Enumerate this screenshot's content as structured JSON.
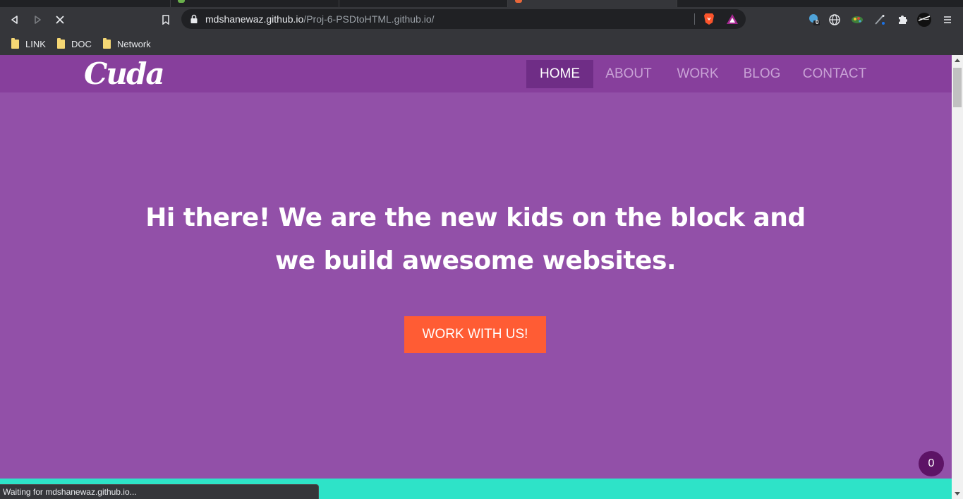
{
  "browser": {
    "url_host": "mdshanewaz.github.io",
    "url_path": "/Proj-6-PSDtoHTML.github.io/",
    "status_text": "Waiting for mdshanewaz.github.io...",
    "extension_badge": "0",
    "bookmarks": [
      {
        "label": "LINK"
      },
      {
        "label": "DOC"
      },
      {
        "label": "Network"
      }
    ],
    "icons": [
      "back-icon",
      "forward-icon",
      "stop-icon",
      "bookmark-icon",
      "lock-icon",
      "brave-shields-icon",
      "brave-rewards-icon",
      "extension-icon",
      "globe-icon",
      "puzzle-icon",
      "profile-icon",
      "menu-icon"
    ]
  },
  "site": {
    "logo": "Cuda",
    "nav": [
      {
        "label": "HOME",
        "active": true
      },
      {
        "label": "ABOUT",
        "active": false
      },
      {
        "label": "WORK",
        "active": false
      },
      {
        "label": "BLOG",
        "active": false
      },
      {
        "label": "CONTACT",
        "active": false
      }
    ],
    "hero": {
      "title": "Hi there! We are the new kids on the block and we build awesome websites.",
      "cta": "WORK WITH US!"
    },
    "badge_count": "0",
    "colors": {
      "header": "#873f9c",
      "hero": "#9250a8",
      "nav_active": "#6f2d86",
      "cta": "#ff5c34",
      "teal": "#2ee3c8",
      "badge": "#5d1366"
    }
  }
}
